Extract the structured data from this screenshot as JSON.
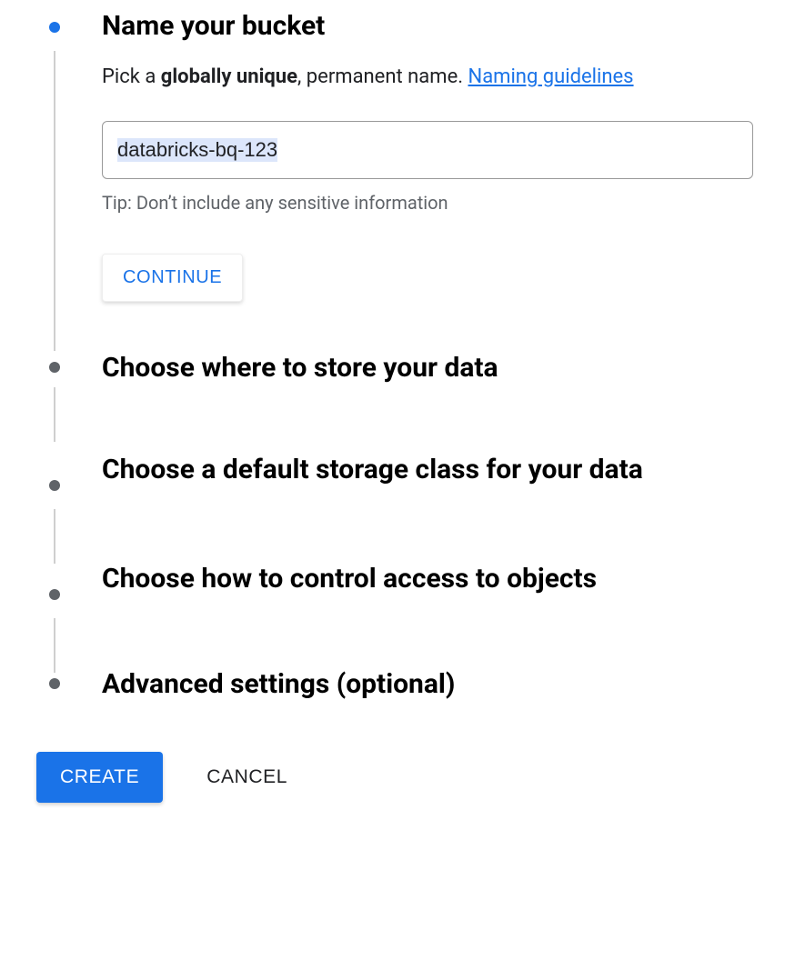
{
  "steps": {
    "name": {
      "title": "Name your bucket",
      "desc_prefix": "Pick a ",
      "desc_bold": "globally unique",
      "desc_suffix": ", permanent name. ",
      "link": "Naming guidelines",
      "input_value": "databricks-bq-123",
      "tip": "Tip: Don’t include any sensitive information",
      "continue_label": "CONTINUE"
    },
    "location": {
      "title": "Choose where to store your data"
    },
    "storage_class": {
      "title": "Choose a default storage class for your data"
    },
    "access": {
      "title": "Choose how to control access to objects"
    },
    "advanced": {
      "title": "Advanced settings (optional)"
    }
  },
  "footer": {
    "create_label": "CREATE",
    "cancel_label": "CANCEL"
  }
}
